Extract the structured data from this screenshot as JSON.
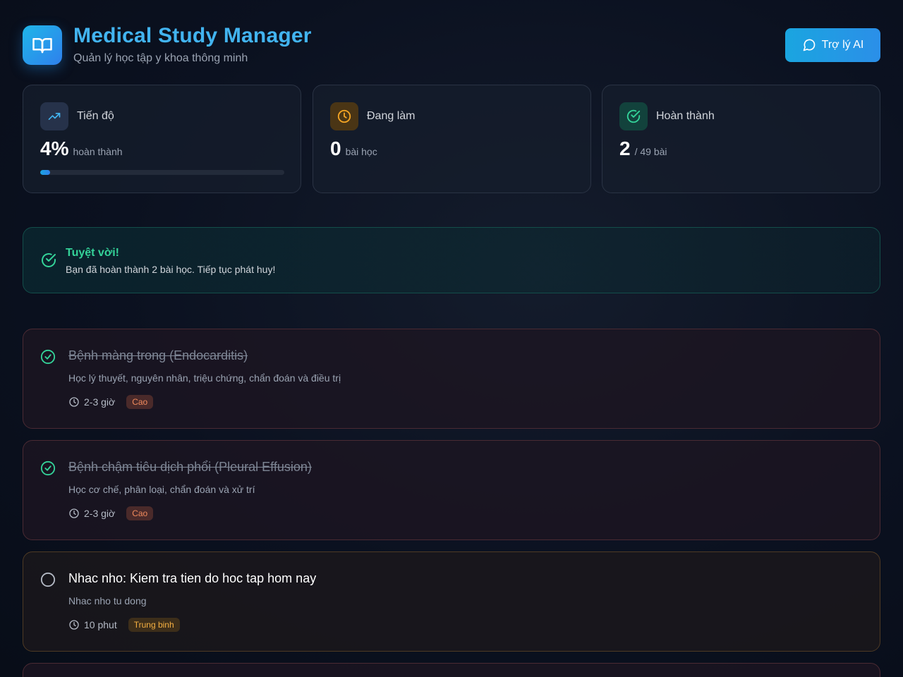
{
  "header": {
    "title": "Medical Study Manager",
    "subtitle": "Quản lý học tập y khoa thông minh",
    "ai_button_label": "Trợ lý AI"
  },
  "stats": [
    {
      "label": "Tiến độ",
      "value": "4%",
      "unit": "hoàn thành",
      "icon": "trending-up-icon",
      "progress": 4
    },
    {
      "label": "Đang làm",
      "value": "0",
      "unit": "bài học",
      "icon": "clock-icon"
    },
    {
      "label": "Hoàn thành",
      "value": "2",
      "unit": "/ 49 bài",
      "icon": "check-circle-icon"
    }
  ],
  "banner": {
    "title": "Tuyệt vời!",
    "text": "Bạn đã hoàn thành 2 bài học. Tiếp tục phát huy!"
  },
  "tasks": [
    {
      "title": "Bệnh màng trong (Endocarditis)",
      "description": "Học lý thuyết, nguyên nhân, triệu chứng, chẩn đoán và điều trị",
      "duration": "2-3 giờ",
      "priority": "Cao",
      "done": true
    },
    {
      "title": "Bệnh chậm tiêu dịch phổi (Pleural Effusion)",
      "description": "Học cơ chế, phân loại, chẩn đoán và xử trí",
      "duration": "2-3 giờ",
      "priority": "Cao",
      "done": true
    },
    {
      "title": "Nhac nho: Kiem tra tien do hoc tap hom nay",
      "description": "Nhac nho tu dong",
      "duration": "10 phut",
      "priority": "Trung binh",
      "done": false
    }
  ],
  "colors": {
    "accent": "#42b4f0",
    "success": "#34d399",
    "warning": "#f5a524",
    "high_priority": "#f08a5d"
  }
}
